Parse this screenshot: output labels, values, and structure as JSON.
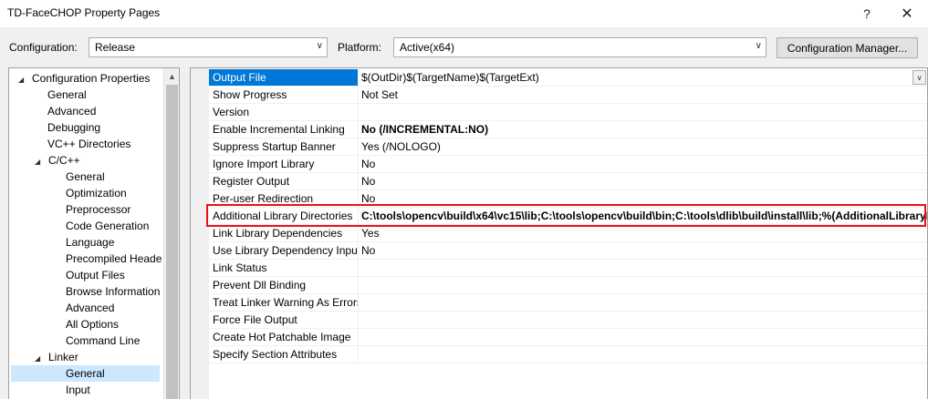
{
  "window": {
    "title": "TD-FaceCHOP Property Pages",
    "help_glyph": "?",
    "close_glyph": "✕"
  },
  "config_bar": {
    "configuration_label": "Configuration:",
    "configuration_value": "Release",
    "platform_label": "Platform:",
    "platform_value": "Active(x64)",
    "manager_button": "Configuration Manager..."
  },
  "tree": {
    "items": [
      {
        "label": "Configuration Properties",
        "expander": "◢"
      },
      {
        "label": "General"
      },
      {
        "label": "Advanced"
      },
      {
        "label": "Debugging"
      },
      {
        "label": "VC++ Directories"
      },
      {
        "label": "C/C++",
        "expander": "◢"
      },
      {
        "label": "General"
      },
      {
        "label": "Optimization"
      },
      {
        "label": "Preprocessor"
      },
      {
        "label": "Code Generation"
      },
      {
        "label": "Language"
      },
      {
        "label": "Precompiled Heade"
      },
      {
        "label": "Output Files"
      },
      {
        "label": "Browse Information"
      },
      {
        "label": "Advanced"
      },
      {
        "label": "All Options"
      },
      {
        "label": "Command Line"
      },
      {
        "label": "Linker",
        "expander": "◢"
      },
      {
        "label": "General",
        "selected": true
      },
      {
        "label": "Input"
      }
    ]
  },
  "properties": {
    "rows": [
      {
        "name": "Output File",
        "value": "$(OutDir)$(TargetName)$(TargetExt)",
        "selected": true
      },
      {
        "name": "Show Progress",
        "value": "Not Set"
      },
      {
        "name": "Version",
        "value": ""
      },
      {
        "name": "Enable Incremental Linking",
        "value": "No (/INCREMENTAL:NO)",
        "bold": true
      },
      {
        "name": "Suppress Startup Banner",
        "value": "Yes (/NOLOGO)"
      },
      {
        "name": "Ignore Import Library",
        "value": "No"
      },
      {
        "name": "Register Output",
        "value": "No"
      },
      {
        "name": "Per-user Redirection",
        "value": "No"
      },
      {
        "name": "Additional Library Directories",
        "value": "C:\\tools\\opencv\\build\\x64\\vc15\\lib;C:\\tools\\opencv\\build\\bin;C:\\tools\\dlib\\build\\install\\lib;%(AdditionalLibraryDirectories)",
        "bold": true
      },
      {
        "name": "Link Library Dependencies",
        "value": "Yes"
      },
      {
        "name": "Use Library Dependency Input",
        "value": "No"
      },
      {
        "name": "Link Status",
        "value": ""
      },
      {
        "name": "Prevent Dll Binding",
        "value": ""
      },
      {
        "name": "Treat Linker Warning As Errors",
        "value": ""
      },
      {
        "name": "Force File Output",
        "value": ""
      },
      {
        "name": "Create Hot Patchable Image",
        "value": ""
      },
      {
        "name": "Specify Section Attributes",
        "value": ""
      }
    ]
  },
  "icons": {
    "dropdown": "chevron-down-icon",
    "scroll_up": "scroll-up-arrow-icon",
    "expander": "expand-triangle-icon"
  },
  "colors": {
    "selection_blue": "#0078d7",
    "tree_selection": "#cce8ff",
    "highlight_box": "#ee1111"
  }
}
